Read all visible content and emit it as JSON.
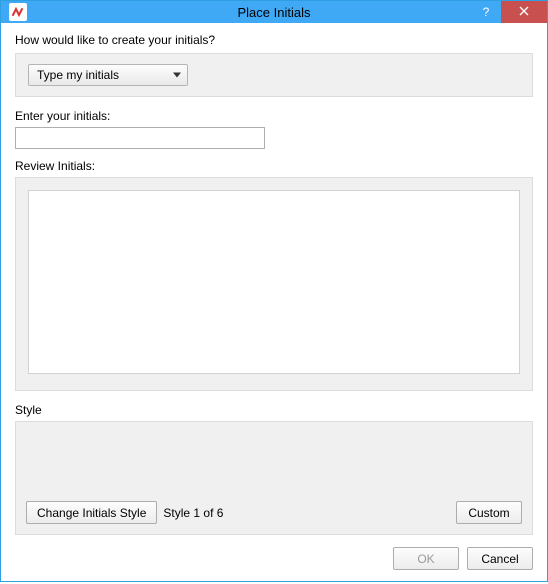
{
  "window": {
    "title": "Place Initials"
  },
  "question": "How would like to create your initials?",
  "method_dropdown": {
    "selected": "Type my initials"
  },
  "enter_label": "Enter your initials:",
  "initials_value": "",
  "review_label": "Review Initials:",
  "style": {
    "label": "Style",
    "change_button": "Change Initials Style",
    "counter": "Style 1 of 6",
    "custom_button": "Custom"
  },
  "buttons": {
    "ok": "OK",
    "cancel": "Cancel"
  }
}
